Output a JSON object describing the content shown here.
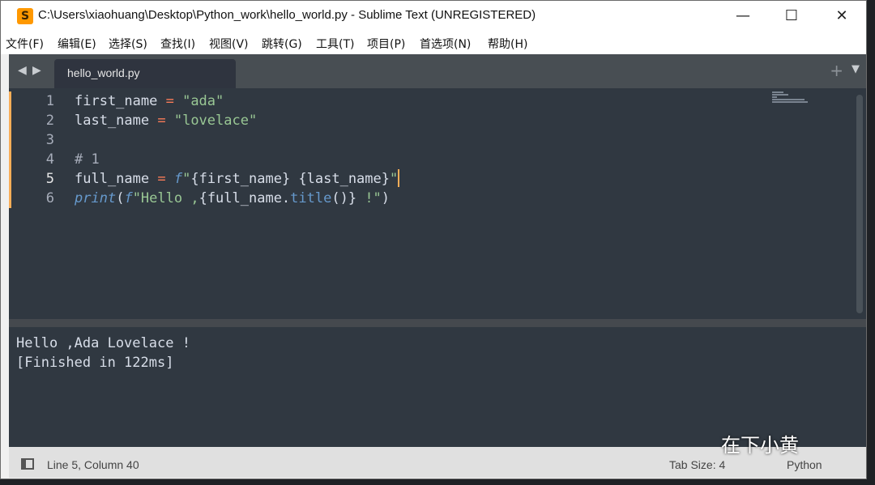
{
  "window": {
    "title": "C:\\Users\\xiaohuang\\Desktop\\Python_work\\hello_world.py - Sublime Text (UNREGISTERED)",
    "app_icon": "S",
    "controls": {
      "minimize": "—",
      "maximize": "☐",
      "close": "✕"
    }
  },
  "menu": [
    "文件(F)",
    "编辑(E)",
    "选择(S)",
    "查找(I)",
    "视图(V)",
    "跳转(G)",
    "工具(T)",
    "项目(P)",
    "首选项(N)",
    "帮助(H)"
  ],
  "tabbar": {
    "back": "◀",
    "forward": "▶",
    "active_tab": "hello_world.py",
    "plus": "+",
    "dropdown": "▼"
  },
  "editor": {
    "line_numbers": [
      "1",
      "2",
      "3",
      "4",
      "5",
      "6"
    ],
    "active_line": 5,
    "lines": [
      [
        {
          "t": "first_name ",
          "c": "var"
        },
        {
          "t": "=",
          "c": "op"
        },
        {
          "t": " \"ada\"",
          "c": "str"
        }
      ],
      [
        {
          "t": "last_name ",
          "c": "var"
        },
        {
          "t": "=",
          "c": "op"
        },
        {
          "t": " \"lovelace\"",
          "c": "str"
        }
      ],
      [],
      [
        {
          "t": "# 1",
          "c": "cmt"
        }
      ],
      [
        {
          "t": "full_name ",
          "c": "var"
        },
        {
          "t": "=",
          "c": "op"
        },
        {
          "t": " ",
          "c": "var"
        },
        {
          "t": "f",
          "c": "kw"
        },
        {
          "t": "\"",
          "c": "str"
        },
        {
          "t": "{first_name} {last_name}",
          "c": "var"
        },
        {
          "t": "\"",
          "c": "str"
        },
        {
          "t": "",
          "c": "cursor"
        }
      ],
      [
        {
          "t": "print",
          "c": "kw"
        },
        {
          "t": "(",
          "c": "var"
        },
        {
          "t": "f",
          "c": "kw"
        },
        {
          "t": "\"Hello ,",
          "c": "str"
        },
        {
          "t": "{full_name.",
          "c": "var"
        },
        {
          "t": "title",
          "c": "fn"
        },
        {
          "t": "()}",
          "c": "var"
        },
        {
          "t": " !\"",
          "c": "str"
        },
        {
          "t": ")",
          "c": "var"
        }
      ]
    ]
  },
  "output": {
    "lines": [
      "Hello ,Ada Lovelace !",
      "[Finished in 122ms]"
    ]
  },
  "status": {
    "position": "Line 5, Column 40",
    "tab_size": "Tab Size: 4",
    "syntax": "Python"
  },
  "watermark": "在下小黄"
}
